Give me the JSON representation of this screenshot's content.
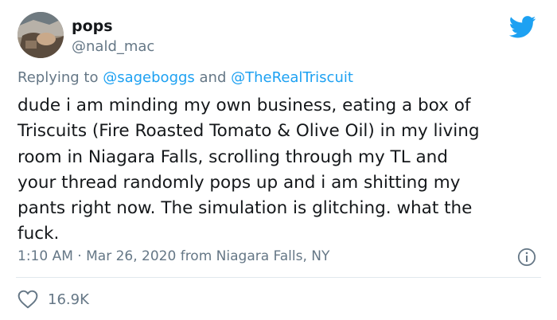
{
  "user": {
    "display_name": "pops",
    "handle": "@nald_mac"
  },
  "reply": {
    "prefix": "Replying to",
    "mentions": [
      "@sageboggs",
      "@TheRealTriscuit"
    ],
    "joiner": "and"
  },
  "tweet": {
    "text": "dude i am minding my own business, eating a box of\nTriscuits (Fire Roasted Tomato & Olive Oil) in my living\nroom in Niagara Falls, scrolling through my TL and\nyour thread randomly pops up and i am shitting my\npants right now. The simulation is glitching. what the\nfuck."
  },
  "meta": {
    "time": "1:10 AM",
    "separator": "·",
    "date": "Mar 26, 2020",
    "location": "from Niagara Falls, NY"
  },
  "stats": {
    "likes": "16.9K"
  },
  "icons": {
    "brand": "twitter-bird-icon",
    "info": "info-icon",
    "like": "heart-icon"
  },
  "colors": {
    "accent": "#1da1f2",
    "muted": "#657786",
    "text": "#14171a",
    "divider": "#e1e8ed"
  }
}
